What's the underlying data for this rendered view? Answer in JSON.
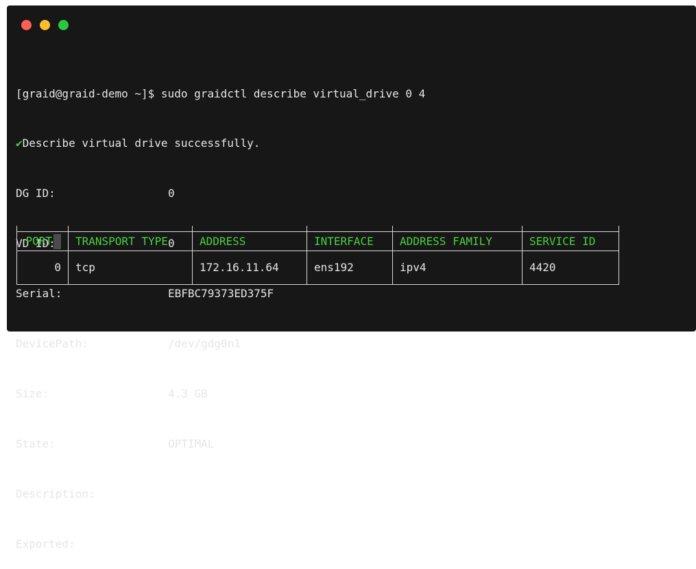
{
  "window": {
    "controls": [
      "close",
      "minimize",
      "zoom"
    ],
    "colors": {
      "background": "#171717",
      "green": "#4bd041",
      "text": "#e6e6e6"
    }
  },
  "terminal": {
    "command_line": "[graid@graid-demo ~]$ sudo graidctl describe virtual_drive 0 4",
    "success_mark": "✔",
    "success_message": "Describe virtual drive successfully.",
    "fields": [
      {
        "key": "DG ID:",
        "value": "0"
      },
      {
        "key": "VD ID:",
        "value": "0"
      },
      {
        "key": "Serial:",
        "value": "EBFBC79373ED375F"
      },
      {
        "key": "DevicePath:",
        "value": "/dev/gdg0n1"
      },
      {
        "key": "Size:",
        "value": "4.3 GB"
      },
      {
        "key": "State:",
        "value": "OPTIMAL"
      },
      {
        "key": "Description:",
        "value": ""
      },
      {
        "key": "Exported:",
        "value": ""
      }
    ],
    "exported_table": {
      "headers": [
        "PORT",
        "TRANSPORT TYPE",
        "ADDRESS",
        "INTERFACE",
        "ADDRESS FAMILY",
        "SERVICE ID"
      ],
      "rows": [
        [
          "0",
          "tcp",
          "172.16.11.64",
          "ens192",
          "ipv4",
          "4420"
        ]
      ]
    }
  }
}
